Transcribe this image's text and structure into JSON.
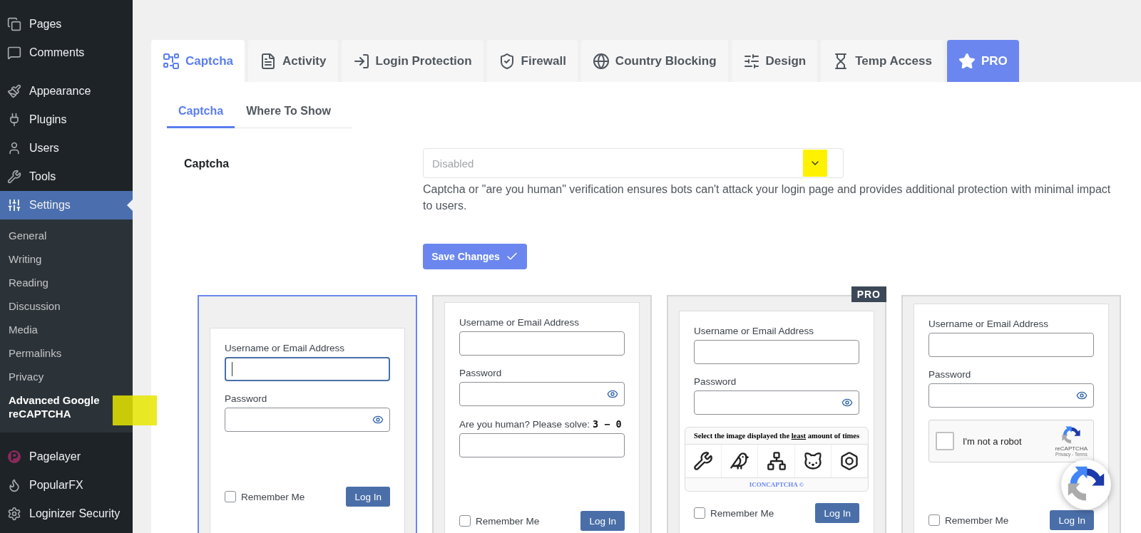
{
  "sidebar": {
    "groups": [
      [
        {
          "label": "Pages",
          "selected": false
        },
        {
          "label": "Comments",
          "selected": false
        }
      ],
      [
        {
          "label": "Appearance",
          "selected": false
        },
        {
          "label": "Plugins",
          "selected": false
        },
        {
          "label": "Users",
          "selected": false
        },
        {
          "label": "Tools",
          "selected": false
        },
        {
          "label": "Settings",
          "selected": true,
          "children": [
            {
              "label": "General",
              "selected": false
            },
            {
              "label": "Writing",
              "selected": false
            },
            {
              "label": "Reading",
              "selected": false
            },
            {
              "label": "Discussion",
              "selected": false
            },
            {
              "label": "Media",
              "selected": false
            },
            {
              "label": "Permalinks",
              "selected": false
            },
            {
              "label": "Privacy",
              "selected": false
            },
            {
              "label": "Advanced Google reCAPTCHA",
              "selected": true
            }
          ]
        }
      ],
      [
        {
          "label": "Pagelayer",
          "selected": false
        },
        {
          "label": "PopularFX",
          "selected": false
        },
        {
          "label": "Loginizer Security",
          "selected": false
        }
      ]
    ]
  },
  "tabs": [
    {
      "label": "Captcha",
      "kind": "normal",
      "selected": true
    },
    {
      "label": "Activity",
      "kind": "normal",
      "selected": false
    },
    {
      "label": "Login Protection",
      "kind": "normal",
      "selected": false
    },
    {
      "label": "Firewall",
      "kind": "normal",
      "selected": false
    },
    {
      "label": "Country Blocking",
      "kind": "normal",
      "selected": false
    },
    {
      "label": "Design",
      "kind": "normal",
      "selected": false
    },
    {
      "label": "Temp Access",
      "kind": "normal",
      "selected": false
    },
    {
      "label": "PRO",
      "kind": "pro",
      "selected": false
    }
  ],
  "subtabs": [
    {
      "label": "Captcha",
      "selected": true
    },
    {
      "label": "Where To Show",
      "selected": false
    }
  ],
  "setting": {
    "label": "Captcha",
    "select": {
      "value": "Disabled"
    },
    "description": "Captcha or \"are you human\" verification ensures bots can't attack your login page and provides additional protection with minimal impact to users."
  },
  "save_button": "Save Changes",
  "cards": [
    {
      "kind": "plain",
      "selected": true,
      "username_label": "Username or Email Address",
      "username_focused": true,
      "password_label": "Password",
      "remember_label": "Remember Me",
      "remember_checked": false,
      "login_button": "Log In"
    },
    {
      "kind": "math",
      "selected": false,
      "username_label": "Username or Email Address",
      "username_focused": false,
      "password_label": "Password",
      "question": "Are you human? Please solve:",
      "equation": "3 − 0",
      "remember_label": "Remember Me",
      "remember_checked": false,
      "login_button": "Log In"
    },
    {
      "kind": "icon",
      "selected": false,
      "badge": "PRO",
      "username_label": "Username or Email Address",
      "username_focused": false,
      "password_label": "Password",
      "heading": "Select the image displayed the **least** amount of times",
      "footer": "ICONCAPTCHA ©",
      "remember_label": "Remember Me",
      "remember_checked": false,
      "login_button": "Log In"
    },
    {
      "kind": "recaptcha",
      "selected": false,
      "username_label": "Username or Email Address",
      "username_focused": false,
      "password_label": "Password",
      "robot_label": "I'm not a robot",
      "robot_checked": false,
      "brand": "reCAPTCHA",
      "links": "Privacy - Terms",
      "remember_label": "Remember Me",
      "remember_checked": false,
      "login_button": "Log In"
    }
  ]
}
